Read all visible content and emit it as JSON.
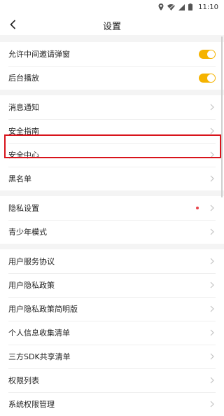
{
  "status": {
    "time": "11:10"
  },
  "header": {
    "title": "设置"
  },
  "toggles": [
    {
      "label": "允许中间邀请弹窗",
      "on": true
    },
    {
      "label": "后台播放",
      "on": true
    }
  ],
  "group1": [
    {
      "label": "消息通知"
    },
    {
      "label": "安全指南"
    },
    {
      "label": "安全中心"
    },
    {
      "label": "黑名单"
    }
  ],
  "group2": [
    {
      "label": "隐私设置"
    },
    {
      "label": "青少年模式"
    }
  ],
  "group3": [
    {
      "label": "用户服务协议"
    },
    {
      "label": "用户隐私政策"
    },
    {
      "label": "用户隐私政策简明版"
    },
    {
      "label": "个人信息收集清单"
    },
    {
      "label": "三方SDK共享清单"
    },
    {
      "label": "权限列表"
    },
    {
      "label": "系统权限管理"
    }
  ],
  "colors": {
    "accent": "#f5b300",
    "highlight": "#d8141c",
    "dot": "#e8434a"
  }
}
